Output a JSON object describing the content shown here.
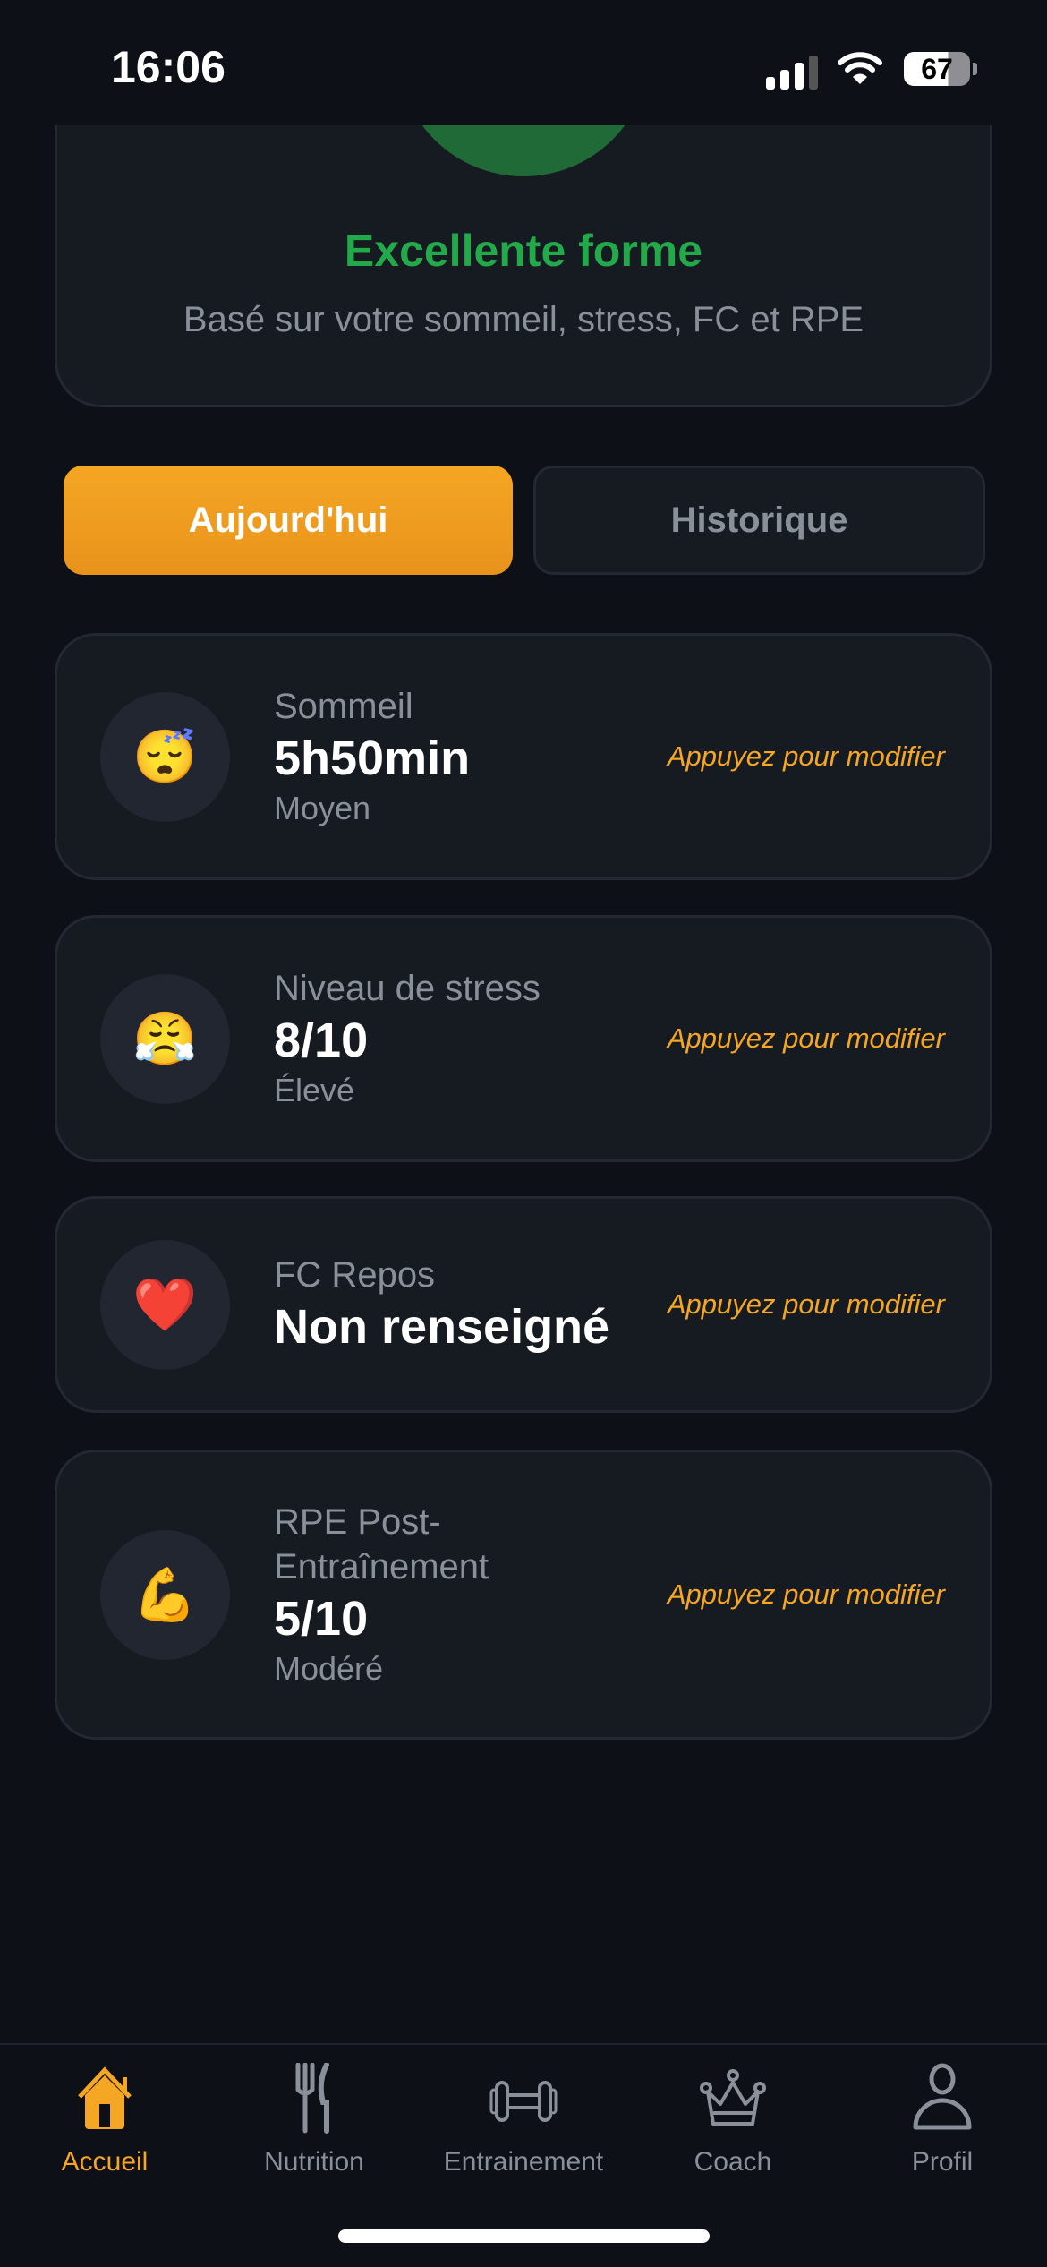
{
  "status_bar": {
    "time": "16:06",
    "battery": "67"
  },
  "summary": {
    "title": "Excellente forme",
    "subtitle": "Basé sur votre sommeil, stress, FC et RPE",
    "color": "#22a94a"
  },
  "tabs": [
    {
      "label": "Aujourd'hui",
      "active": true
    },
    {
      "label": "Historique",
      "active": false
    }
  ],
  "metrics": [
    {
      "icon": "sleeping-face",
      "emoji": "😴",
      "label": "Sommeil",
      "value": "5h50min",
      "status": "Moyen",
      "hint": "Appuyez pour modifier"
    },
    {
      "icon": "steam-face",
      "emoji": "😤",
      "label": "Niveau de stress",
      "value": "8/10",
      "status": "Élevé",
      "hint": "Appuyez pour modifier"
    },
    {
      "icon": "heart",
      "emoji": "❤️",
      "label": "FC Repos",
      "value": "Non renseigné",
      "hint": "Appuyez pour modifier"
    },
    {
      "icon": "flexed-biceps",
      "emoji": "💪",
      "label": "RPE Post-Entraînement",
      "value": "5/10",
      "status": "Modéré",
      "hint": "Appuyez pour modifier"
    }
  ],
  "nav": [
    {
      "label": "Accueil",
      "active": true
    },
    {
      "label": "Nutrition"
    },
    {
      "label": "Entrainement"
    },
    {
      "label": "Coach"
    },
    {
      "label": "Profil"
    }
  ],
  "accent": "#f5a623"
}
